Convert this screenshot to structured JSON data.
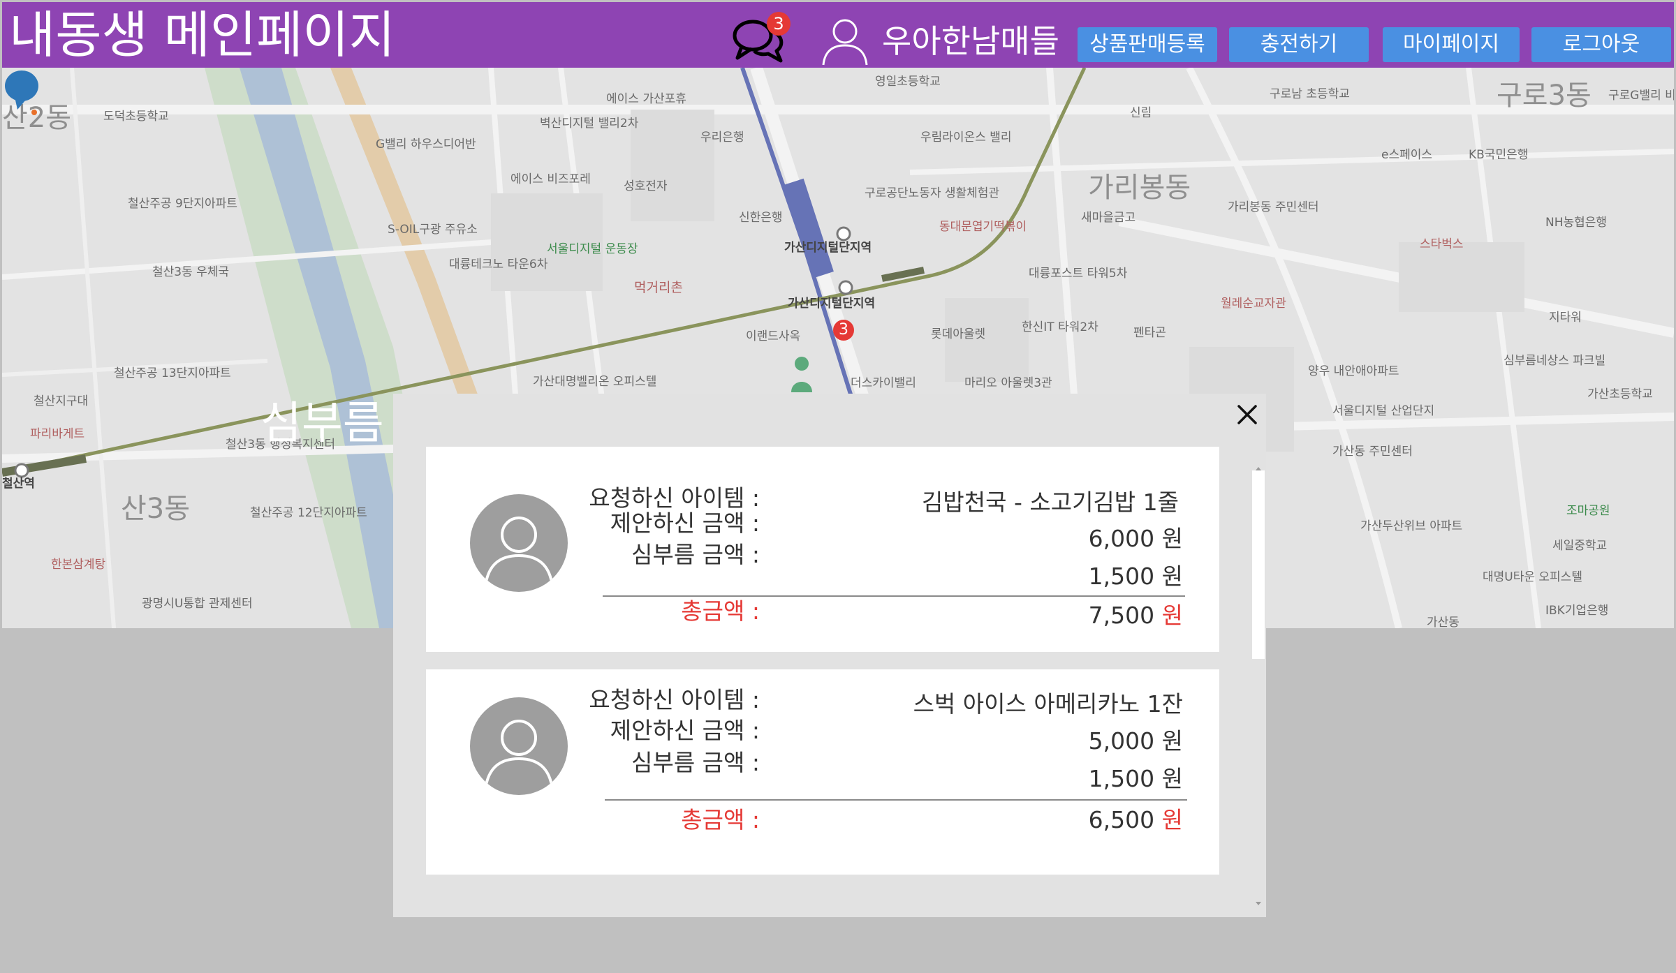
{
  "header": {
    "title": "내동생 메인페이지",
    "chat_badge": "3",
    "username": "우아한남매들",
    "buttons": {
      "sell": "상품판매등록",
      "charge": "충전하기",
      "mypage": "마이페이지",
      "logout": "로그아웃"
    },
    "colors": {
      "bar": "#8e44b3",
      "button": "#4a90e2",
      "badge": "#e53935"
    }
  },
  "map": {
    "caption": "심부름 리스트 모달창",
    "pin_badge": "3",
    "labels": {
      "gasan_digital": "가산디지털단지역",
      "gasan_digital2": "가산디지털단지역",
      "garibong": "가리봉동",
      "guro3": "구로3동",
      "cheolsan2": "산2동",
      "cheolsan3": "산3동",
      "cheolsan_station": "철산역",
      "meokgeori": "먹거리촌",
      "shinhan": "신한은행",
      "woori": "우리은행",
      "kb": "KB국민은행",
      "nh": "NH농협은행",
      "ibk": "IBK기업은행",
      "doseong": "도덕초등학교",
      "gallery": "G밸리 하우스디어반",
      "ace": "에이스 가산포휴",
      "sungho": "성호전자",
      "seoul_digital": "서울디지털 운동장",
      "soil": "S-OIL구광 주유소",
      "cheolsan_jugong": "철산주공 9단지아파트",
      "sewoo": "세일중학교",
      "jomapark": "조마공원",
      "gasan_school": "가산초등학교",
      "yeongil": "영일초등학교",
      "guro_cafe": "구로공단노동자 생활체험관",
      "daeryung": "대륭포스트 타워5차",
      "lotte": "롯데아울렛",
      "hanshin": "한신IT 타워2차",
      "starbucks": "스타벅스",
      "garibong_center": "가리봉동 주민센터",
      "saemaeul": "새마을금고",
      "gasan_wellite": "가산두산위브 아파트",
      "daeryung_u": "대명U타운 오피스텔",
      "gasandong_center": "가산동 주민센터",
      "cheolsan_jigu": "철산지구대",
      "paris": "파리바게트",
      "gwangmyeong": "광명시U통합 관제센터",
      "hanbon": "한본삼계탕",
      "cheolsan13": "철산주공 13단지아파트",
      "cheolsan12": "철산주공 12단지아파트",
      "cheolsan3dong_center": "철산3동 행정복지센터",
      "cheolsan3_post": "철산3동 우체국",
      "eland": "이랜드사옥",
      "daerim": "대륭테크노 타운6차",
      "gasan_post": "가산대명벨리온 오피스텔",
      "thesky": "더스카이밸리",
      "mario": "마리오 아울렛3관",
      "daedong": "동대문엽기떡볶이",
      "bikkeul": "벽산디지털 밸리2차",
      "ace_biz": "에이스 비즈포레",
      "woorim": "우림라이온스 밸리",
      "ibk_station": "가산동",
      "jitaewu": "지타워",
      "guro_school": "구로남 초등학교",
      "sinrim": "신림",
      "guro_g": "구로G밸리 비즈플라자",
      "neighbor": "양우 내안애아파트",
      "seoul_digital_ind": "서울디지털 산업단지",
      "woolrimsoon": "월레순교자관",
      "pentagon": "펜타곤",
      "epaceseu": "e스페이스",
      "simburm_park": "심부름네상스 파크빌"
    }
  },
  "modal": {
    "items": [
      {
        "label_item": "요청하신 아이템 :",
        "label_offer": "제안하신 금액 :",
        "label_fee": "심부름 금액 :",
        "label_total": "총금액 :",
        "item": "김밥천국 - 소고기김밥 1줄",
        "offer": "6,000 원",
        "fee": "1,500 원",
        "total_amount": "7,500",
        "total_unit": "원"
      },
      {
        "label_item": "요청하신 아이템 :",
        "label_offer": "제안하신 금액 :",
        "label_fee": "심부름 금액 :",
        "label_total": "총금액 :",
        "item": "스벅 아이스 아메리카노 1잔",
        "offer": "5,000 원",
        "fee": "1,500 원",
        "total_amount": "6,500",
        "total_unit": "원"
      }
    ]
  }
}
